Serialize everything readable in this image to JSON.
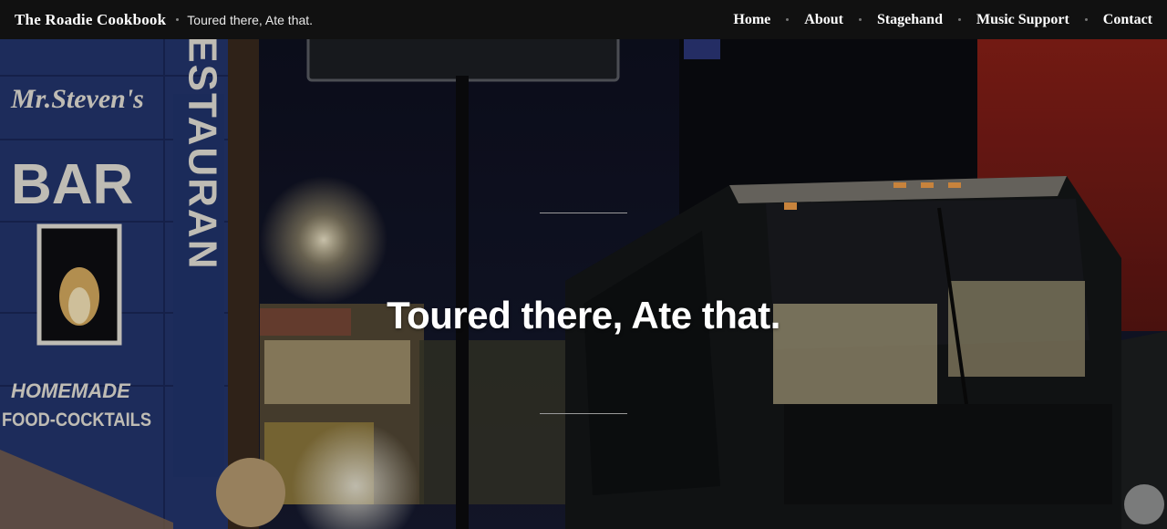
{
  "header": {
    "site_title": "The Roadie Cookbook",
    "tagline": "Toured there, Ate that."
  },
  "nav": {
    "items": [
      {
        "label": "Home"
      },
      {
        "label": "About"
      },
      {
        "label": "Stagehand"
      },
      {
        "label": "Music Support"
      },
      {
        "label": "Contact"
      }
    ]
  },
  "hero": {
    "title": "Toured there, Ate that.",
    "image": {
      "sign_name": "Mr.Steven's",
      "sign_bar": "BAR",
      "sign_vertical": "RESTAURAN",
      "sign_homemade": "HOMEMADE",
      "sign_food": "FOOD-COCKTAILS"
    }
  },
  "colors": {
    "topbar": "#111111",
    "wall_blue": "#2a3d7a",
    "wall_red": "#8a1e1a",
    "bus_body": "#141618",
    "sign_text": "#e9e6dc"
  }
}
